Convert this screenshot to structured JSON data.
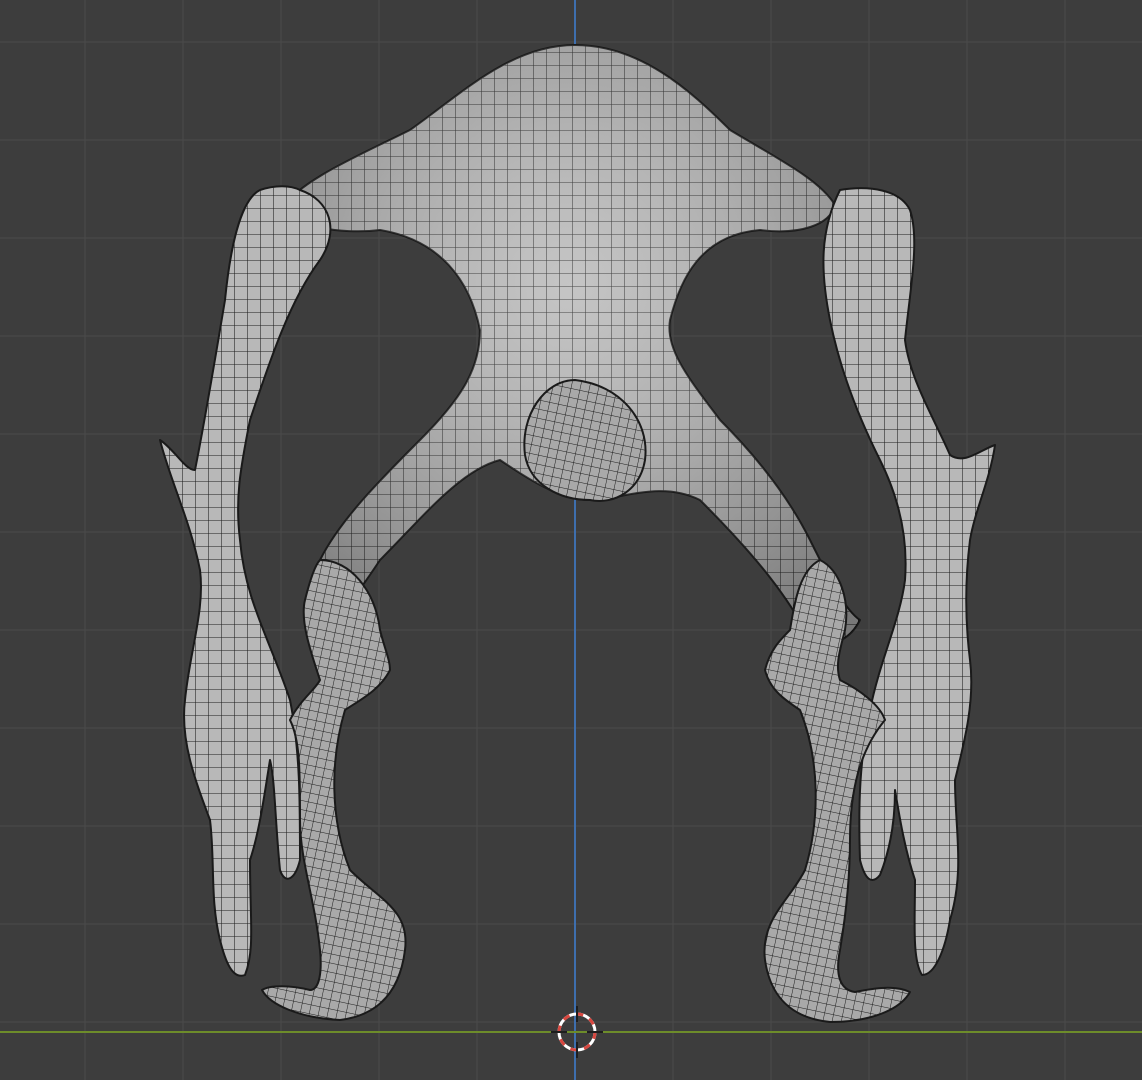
{
  "viewport": {
    "background_color": "#3d3d3d",
    "grid_color": "#4a4a4a",
    "axis_z_color": "#3e6fae",
    "axis_y_color": "#6d8c2a",
    "mesh_fill_color": "#b8b8b8",
    "mesh_wire_color": "#1c1c1c",
    "cursor_colors": [
      "#d9473f",
      "#ffffff"
    ],
    "icons": {
      "cursor": "3d-cursor-icon"
    }
  }
}
